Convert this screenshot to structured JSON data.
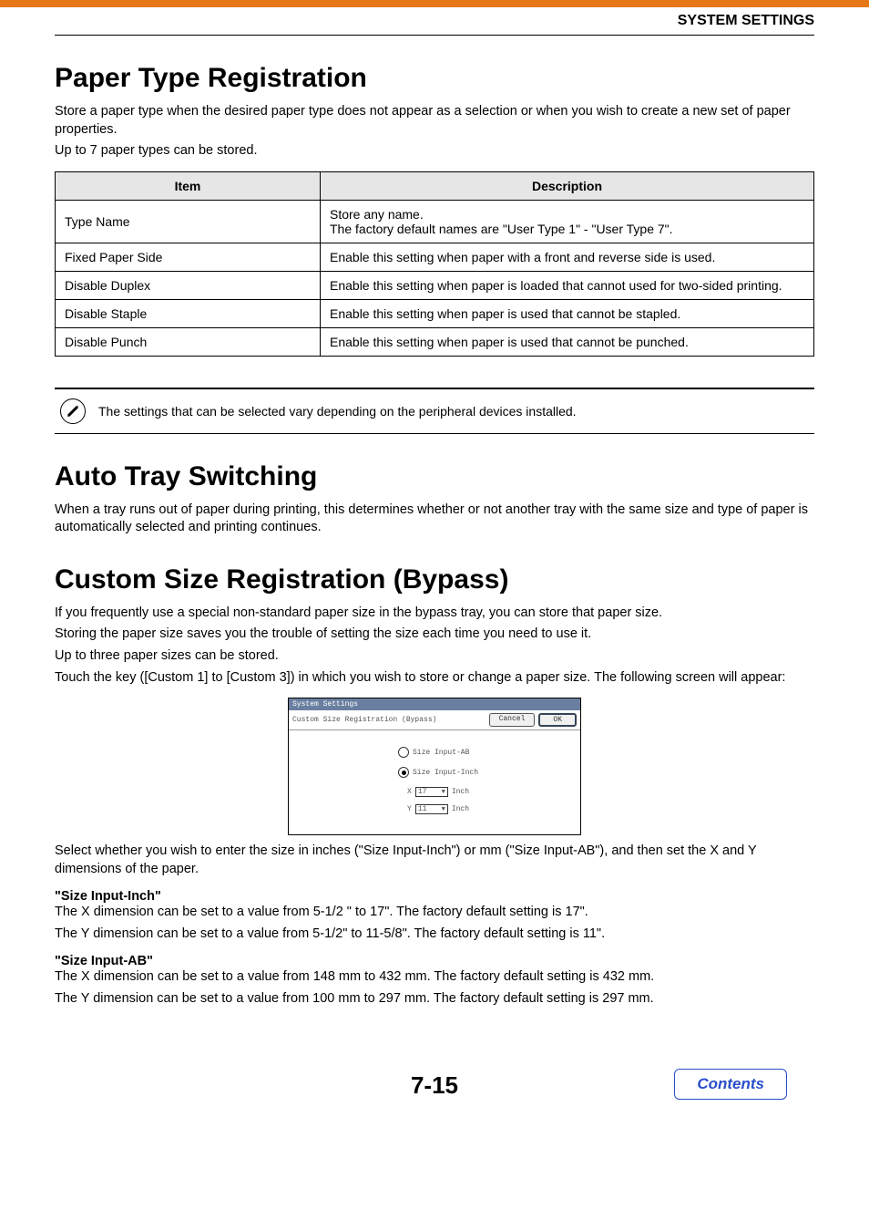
{
  "header": {
    "title": "SYSTEM SETTINGS"
  },
  "section1": {
    "heading": "Paper Type Registration",
    "p1": "Store a paper type when the desired paper type does not appear as a selection or when you wish to create a new set of paper properties.",
    "p2": "Up to 7 paper types can be stored.",
    "table": {
      "head_item": "Item",
      "head_desc": "Description",
      "rows": [
        {
          "item": "Type Name",
          "desc": "Store any name.\nThe factory default names are \"User Type 1\" - \"User Type 7\"."
        },
        {
          "item": "Fixed Paper Side",
          "desc": "Enable this setting when paper with a front and reverse side is used."
        },
        {
          "item": "Disable Duplex",
          "desc": "Enable this setting when paper is loaded that cannot used for two-sided printing."
        },
        {
          "item": "Disable Staple",
          "desc": "Enable this setting when paper is used that cannot be stapled."
        },
        {
          "item": "Disable Punch",
          "desc": "Enable this setting when paper is used that cannot be punched."
        }
      ]
    },
    "note": "The settings that can be selected vary depending on the peripheral devices installed."
  },
  "section2": {
    "heading": "Auto Tray Switching",
    "p1": "When a tray runs out of paper during printing, this determines whether or not another tray with the same size and type of paper is automatically selected and printing continues."
  },
  "section3": {
    "heading": "Custom Size Registration (Bypass)",
    "p1": "If you frequently use a special non-standard paper size in the bypass tray, you can store that paper size.",
    "p2": "Storing the paper size saves you the trouble of setting the size each time you need to use it.",
    "p3": "Up to three paper sizes can be stored.",
    "p4": "Touch the key ([Custom 1] to [Custom 3]) in which you wish to store or change a paper size. The following screen will appear:",
    "screenshot": {
      "titlebar": "System Settings",
      "subtitle": "Custom Size Registration (Bypass)",
      "cancel": "Cancel",
      "ok": "OK",
      "radio_ab": "Size Input-AB",
      "radio_inch": "Size Input-Inch",
      "x_label": "X",
      "x_value": "17",
      "x_unit": "Inch",
      "y_label": "Y",
      "y_value": "11",
      "y_unit": "Inch"
    },
    "p5": "Select whether you wish to enter the size in inches (\"Size Input-Inch\") or mm (\"Size Input-AB\"), and then set the X and Y dimensions of the paper.",
    "sub_inch": "\"Size Input-Inch\"",
    "inch_x": "The X dimension can be set to a value from 5-1/2 \" to 17\". The factory default setting is 17\".",
    "inch_y": "The Y dimension can be set to a value from 5-1/2\" to 11-5/8\". The factory default setting is 11\".",
    "sub_ab": "\"Size Input-AB\"",
    "ab_x": "The X dimension can be set to a value from 148 mm to 432 mm. The factory default setting is 432 mm.",
    "ab_y": "The Y dimension can be set to a value from 100 mm to 297 mm. The factory default setting is 297 mm."
  },
  "footer": {
    "page": "7-15",
    "contents": "Contents"
  }
}
